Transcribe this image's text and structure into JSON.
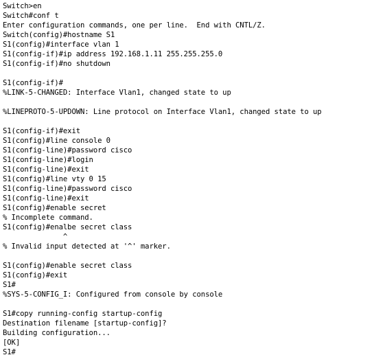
{
  "terminal": {
    "lines": [
      "Switch>en",
      "Switch#conf t",
      "Enter configuration commands, one per line.  End with CNTL/Z.",
      "Switch(config)#hostname S1",
      "S1(config)#interface vlan 1",
      "S1(config-if)#ip address 192.168.1.11 255.255.255.0",
      "S1(config-if)#no shutdown",
      "",
      "S1(config-if)#",
      "%LINK-5-CHANGED: Interface Vlan1, changed state to up",
      "",
      "%LINEPROTO-5-UPDOWN: Line protocol on Interface Vlan1, changed state to up",
      "",
      "S1(config-if)#exit",
      "S1(config)#line console 0",
      "S1(config-line)#password cisco",
      "S1(config-line)#login",
      "S1(config-line)#exit",
      "S1(config)#line vty 0 15",
      "S1(config-line)#password cisco",
      "S1(config-line)#exit",
      "S1(config)#enable secret",
      "% Incomplete command.",
      "S1(config)#enalbe secret class",
      "              ^",
      "% Invalid input detected at '^' marker.",
      "",
      "S1(config)#enable secret class",
      "S1(config)#exit",
      "S1#",
      "%SYS-5-CONFIG_I: Configured from console by console",
      "",
      "S1#copy running-config startup-config",
      "Destination filename [startup-config]?",
      "Building configuration...",
      "[OK]",
      "S1#"
    ]
  }
}
